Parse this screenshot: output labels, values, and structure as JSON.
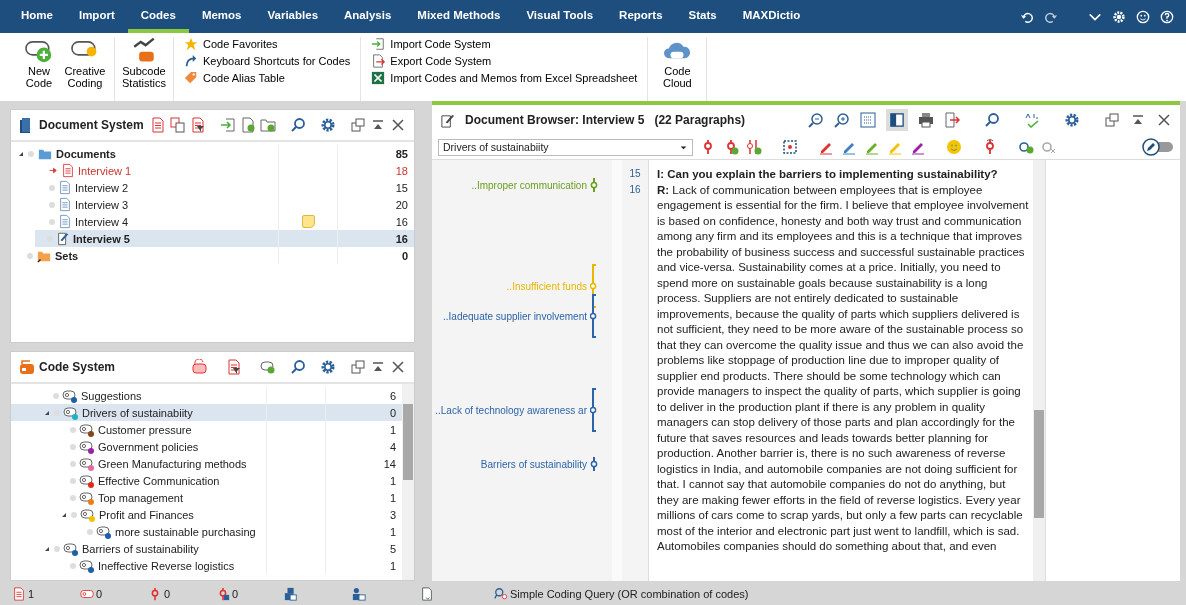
{
  "menu_tabs": [
    {
      "label": "Home",
      "selected": false
    },
    {
      "label": "Import",
      "selected": false
    },
    {
      "label": "Codes",
      "selected": true
    },
    {
      "label": "Memos",
      "selected": false
    },
    {
      "label": "Variables",
      "selected": false
    },
    {
      "label": "Analysis",
      "selected": false
    },
    {
      "label": "Mixed Methods",
      "selected": false
    },
    {
      "label": "Visual Tools",
      "selected": false
    },
    {
      "label": "Reports",
      "selected": false
    },
    {
      "label": "Stats",
      "selected": false
    },
    {
      "label": "MAXDictio",
      "selected": false
    }
  ],
  "ribbon": {
    "large_buttons_left": [
      {
        "label": "New Code",
        "kind": "new"
      },
      {
        "label": "Creative Coding",
        "kind": "creative"
      },
      {
        "label": "Subcode Statistics",
        "kind": "stats"
      }
    ],
    "small_buttons_1": [
      {
        "label": "Code Favorites",
        "kind": "star"
      },
      {
        "label": "Keyboard Shortcuts for Codes",
        "kind": "shortcut"
      },
      {
        "label": "Code Alias Table",
        "kind": "tag"
      }
    ],
    "small_buttons_2": [
      {
        "label": "Import Code System",
        "kind": "import"
      },
      {
        "label": "Export Code System",
        "kind": "export"
      },
      {
        "label": "Import Codes and Memos from Excel Spreadsheet",
        "kind": "excel"
      }
    ],
    "large_buttons_right": [
      {
        "label": "Code Cloud",
        "kind": "cloud"
      }
    ]
  },
  "document_system": {
    "title": "Document System",
    "items": [
      {
        "name": "Documents",
        "count": "85",
        "kind": "folder",
        "selected": false,
        "active": false,
        "memo": false,
        "expanded": true,
        "children": [
          {
            "name": "Interview 1",
            "count": "18",
            "kind": "document",
            "selected": false,
            "active": true,
            "memo": false
          },
          {
            "name": "Interview 2",
            "count": "15",
            "kind": "document",
            "selected": false,
            "active": false,
            "memo": false
          },
          {
            "name": "Interview 3",
            "count": "20",
            "kind": "document",
            "selected": false,
            "active": false,
            "memo": false
          },
          {
            "name": "Interview 4",
            "count": "16",
            "kind": "document",
            "selected": false,
            "active": false,
            "memo": true
          },
          {
            "name": "Interview 5",
            "count": "16",
            "kind": "document",
            "selected": true,
            "active": false,
            "memo": false
          }
        ]
      },
      {
        "name": "Sets",
        "count": "0",
        "kind": "set",
        "selected": false,
        "active": false,
        "memo": false
      }
    ]
  },
  "code_system": {
    "title": "Code System",
    "items": [
      {
        "name": "Suggestions",
        "count": "6",
        "color": "#1f5fa8",
        "selected": false
      },
      {
        "name": "Drivers of sustainabiity",
        "count": "0",
        "color": "#19b5c6",
        "selected": true,
        "expanded": true,
        "children": [
          {
            "name": "Customer pressure",
            "count": "1",
            "color": "#8b4513",
            "selected": false
          },
          {
            "name": "Government policies",
            "count": "4",
            "color": "#9b1fa8",
            "selected": false
          },
          {
            "name": "Green Manufacturing methods",
            "count": "14",
            "color": "#e06aa8",
            "selected": false
          },
          {
            "name": "Effective Communication",
            "count": "1",
            "color": "#e02a1a",
            "selected": false
          },
          {
            "name": "Top management",
            "count": "1",
            "color": "#f07d14",
            "selected": false
          },
          {
            "name": "Profit and Finances",
            "count": "3",
            "color": "#f2c200",
            "selected": false,
            "expanded": true,
            "children": [
              {
                "name": "more sustainable purchasing",
                "count": "1",
                "color": "#1f5fa8",
                "selected": false
              }
            ]
          }
        ]
      },
      {
        "name": "Barriers of sustainability",
        "count": "5",
        "color": "#1f5fa8",
        "selected": false,
        "expanded": true,
        "children": [
          {
            "name": "Ineffective Reverse logistics",
            "count": "1",
            "color": "#1f5fa8",
            "selected": false
          }
        ]
      }
    ]
  },
  "document_browser": {
    "title": "Document Browser: Interview 5",
    "paragraph_count": "(22 Paragraphs)",
    "code_dropdown": "Drivers of sustainabiity",
    "codings": [
      {
        "label": "..Improper communication",
        "color": "#6a9e1f",
        "kind": "point"
      },
      {
        "label": "..Insufficient funds",
        "color": "#e8b800",
        "kind": "bracket"
      },
      {
        "label": "..Iadequate supplier involvement",
        "color": "#2c64a8",
        "kind": "bracket"
      },
      {
        "label": "..Lack of technology awareness ar",
        "color": "#2c64a8",
        "kind": "bracket"
      },
      {
        "label": "Barriers of sustainability",
        "color": "#2c64a8",
        "kind": "point"
      }
    ],
    "paragraphs": [
      {
        "number": "15",
        "text": "I: Can you explain the barriers to implementing sustainability?",
        "kind": "question"
      },
      {
        "number": "16",
        "text": "**R:** Lack of communication between employees that is employee engagement is essential for the firm. I believe that employee involvement is based on confidence, honesty and both way trust and communication among any firm and its employees and this is a technique that improves the probability of business success and successful sustainable practices and vice-versa. Sustainability comes at a price. Initially, you need to spend more on sustainable goals because sustainability is a long process. Suppliers are not entirely dedicated to sustainable improvements, because the quality of parts which suppliers delivered is not sufficient, they need to be more aware of the sustainable process so that they can overcome the quality issue and thus we can also avoid the problems like stoppage of production line due to improper quality of supplier end products. There should be some technology which can provide managers to inspect the quality of parts, which supplier is going to deliver in the production plant if there is any problem in quality managers can stop delivery of those parts and plan accordingly for the future that saves resources and leads towards better planning for production. Another barrier is, there is no such awareness of reverse logistics in India, and automobile companies are not doing sufficient for that. I cannot say that automobile companies do not do anything, but they are making fewer efforts in the field of reverse logistics. Every year millions of cars come to scrap yards, but only a few parts can recyclable most of the interior and electronic part just went to landfill, which is sad. Automobiles companies should do something about that, and even",
        "kind": "answer"
      }
    ]
  },
  "status_bar": {
    "counts": [
      {
        "value": "1",
        "kind": "documents"
      },
      {
        "value": "0",
        "kind": "codes"
      },
      {
        "value": "0",
        "kind": "codings"
      },
      {
        "value": "0",
        "kind": "weights"
      }
    ],
    "query": "Simple Coding Query (OR combination of codes)"
  }
}
